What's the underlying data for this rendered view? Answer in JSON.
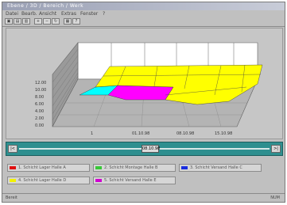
{
  "window": {
    "title": "Ebene / 3D / Bereich / Werk"
  },
  "menubar": [
    "Datei",
    "Bearb.",
    "Ansicht",
    "Extras",
    "Fenster",
    "?"
  ],
  "toolbar": [
    {
      "icon": "open-icon",
      "label": "▣"
    },
    {
      "icon": "save-icon",
      "label": "▤"
    },
    {
      "icon": "print-icon",
      "label": "▥"
    },
    {
      "icon": "zoom-in-icon",
      "label": "+"
    },
    {
      "icon": "zoom-out-icon",
      "label": "−"
    },
    {
      "icon": "rotate-icon",
      "label": "↻"
    },
    {
      "icon": "chart-icon",
      "label": "▦"
    },
    {
      "icon": "help-icon",
      "label": "?"
    }
  ],
  "axes": {
    "y_ticks": [
      "12.00",
      "10.00",
      "8.00",
      "6.00",
      "4.00",
      "2.00",
      "0.00"
    ],
    "x_ticks": [
      "1",
      "01.10.98",
      "08.10.98",
      "15.10.98"
    ]
  },
  "slider": {
    "left_cap": "|<",
    "right_cap": ">|",
    "thumb_label": "08.10.98"
  },
  "legend": [
    {
      "color": "#e01010",
      "label": "1. Schicht Lager Halle A"
    },
    {
      "color": "#38c838",
      "label": "2. Schicht Montage Halle B"
    },
    {
      "color": "#1a2ee0",
      "label": "3. Schicht Versand Halle C"
    },
    {
      "color": "#f2f200",
      "label": "4. Schicht Lager Halle D"
    },
    {
      "color": "#d000d0",
      "label": "5. Schicht Versand Halle E"
    }
  ],
  "surface_colors": {
    "yellow": "#ffff00",
    "cyan": "#00ffff",
    "magenta": "#ff00ff"
  },
  "status": {
    "left": "Bereit",
    "center": "",
    "right": "NUM"
  }
}
